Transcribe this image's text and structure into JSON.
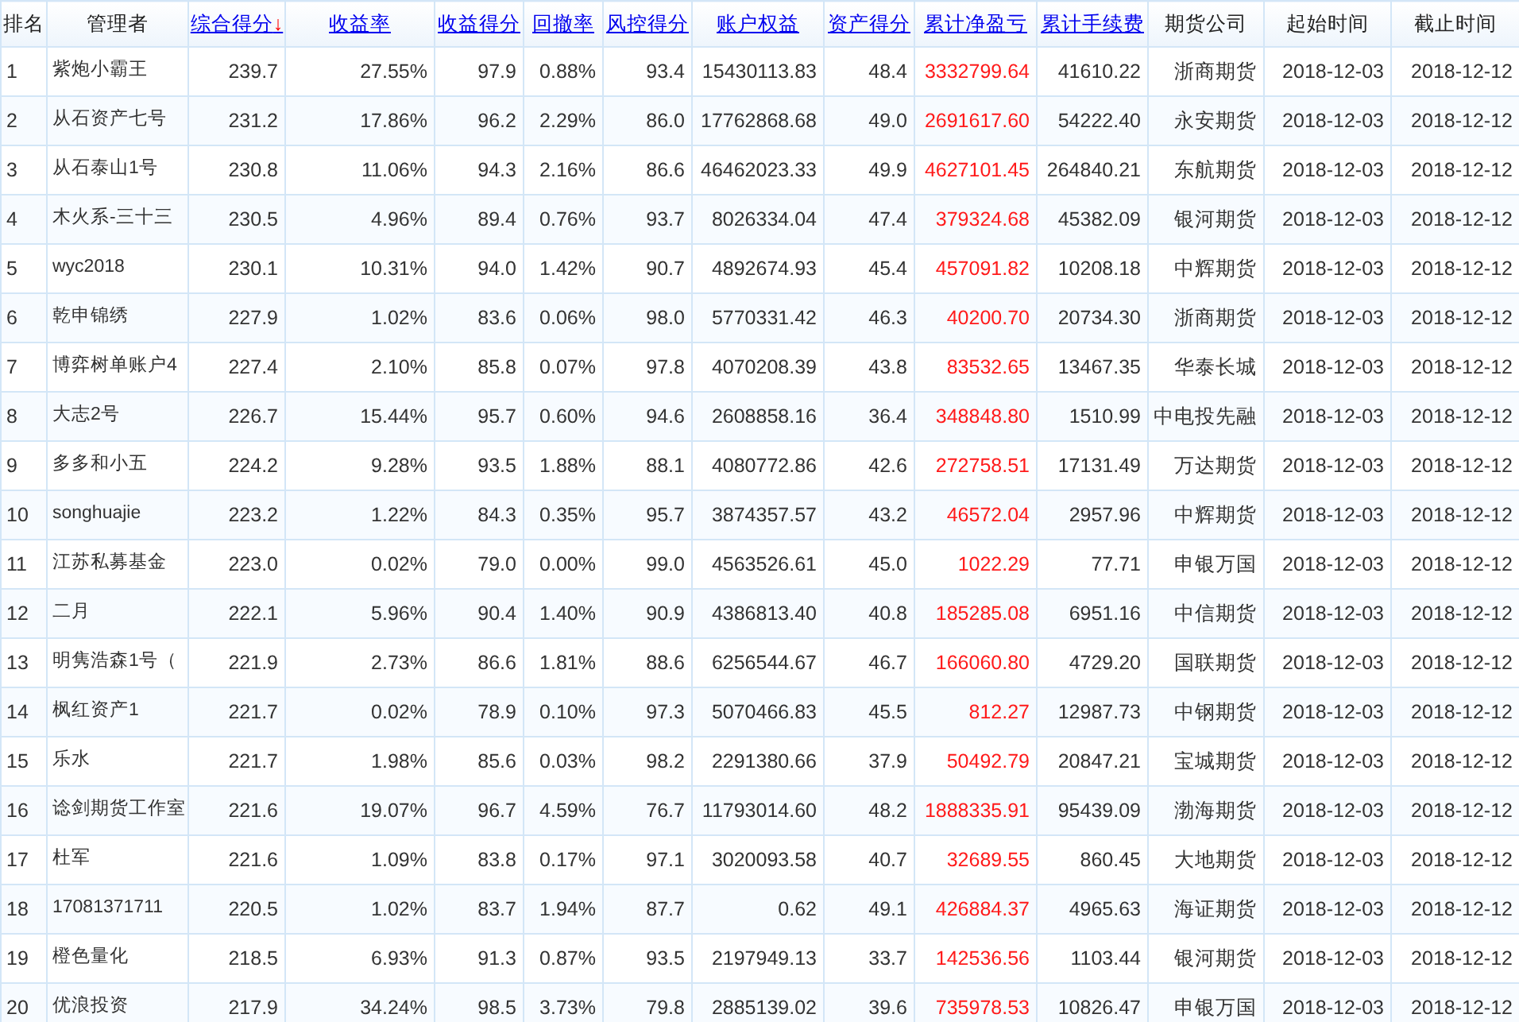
{
  "table": {
    "columns": [
      {
        "label": "排名",
        "sortable": false,
        "kind": "left"
      },
      {
        "label": "管理者",
        "sortable": false,
        "kind": "left"
      },
      {
        "label": "综合得分",
        "sortable": true,
        "sort_indicator": "↓",
        "kind": "number"
      },
      {
        "label": "收益率",
        "sortable": true,
        "kind": "number"
      },
      {
        "label": "收益得分",
        "sortable": true,
        "kind": "number"
      },
      {
        "label": "回撤率",
        "sortable": true,
        "kind": "number"
      },
      {
        "label": "风控得分",
        "sortable": true,
        "kind": "number"
      },
      {
        "label": "账户权益",
        "sortable": true,
        "kind": "number"
      },
      {
        "label": "资产得分",
        "sortable": true,
        "kind": "number"
      },
      {
        "label": "累计净盈亏",
        "sortable": true,
        "kind": "gain"
      },
      {
        "label": "累计手续费",
        "sortable": true,
        "kind": "number"
      },
      {
        "label": "期货公司",
        "sortable": false,
        "kind": "number"
      },
      {
        "label": "起始时间",
        "sortable": false,
        "kind": "number"
      },
      {
        "label": "截止时间",
        "sortable": false,
        "kind": "number"
      }
    ],
    "rows": [
      [
        "1",
        "紫炮小霸王",
        "239.7",
        "27.55%",
        "97.9",
        "0.88%",
        "93.4",
        "15430113.83",
        "48.4",
        "3332799.64",
        "41610.22",
        "浙商期货",
        "2018-12-03",
        "2018-12-12"
      ],
      [
        "2",
        "从石资产七号",
        "231.2",
        "17.86%",
        "96.2",
        "2.29%",
        "86.0",
        "17762868.68",
        "49.0",
        "2691617.60",
        "54222.40",
        "永安期货",
        "2018-12-03",
        "2018-12-12"
      ],
      [
        "3",
        "从石泰山1号",
        "230.8",
        "11.06%",
        "94.3",
        "2.16%",
        "86.6",
        "46462023.33",
        "49.9",
        "4627101.45",
        "264840.21",
        "东航期货",
        "2018-12-03",
        "2018-12-12"
      ],
      [
        "4",
        "木火系-三十三",
        "230.5",
        "4.96%",
        "89.4",
        "0.76%",
        "93.7",
        "8026334.04",
        "47.4",
        "379324.68",
        "45382.09",
        "银河期货",
        "2018-12-03",
        "2018-12-12"
      ],
      [
        "5",
        "wyc2018",
        "230.1",
        "10.31%",
        "94.0",
        "1.42%",
        "90.7",
        "4892674.93",
        "45.4",
        "457091.82",
        "10208.18",
        "中辉期货",
        "2018-12-03",
        "2018-12-12"
      ],
      [
        "6",
        "乾申锦绣",
        "227.9",
        "1.02%",
        "83.6",
        "0.06%",
        "98.0",
        "5770331.42",
        "46.3",
        "40200.70",
        "20734.30",
        "浙商期货",
        "2018-12-03",
        "2018-12-12"
      ],
      [
        "7",
        "博弈树单账户4",
        "227.4",
        "2.10%",
        "85.8",
        "0.07%",
        "97.8",
        "4070208.39",
        "43.8",
        "83532.65",
        "13467.35",
        "华泰长城",
        "2018-12-03",
        "2018-12-12"
      ],
      [
        "8",
        "大志2号",
        "226.7",
        "15.44%",
        "95.7",
        "0.60%",
        "94.6",
        "2608858.16",
        "36.4",
        "348848.80",
        "1510.99",
        "中电投先融",
        "2018-12-03",
        "2018-12-12"
      ],
      [
        "9",
        "多多和小五",
        "224.2",
        "9.28%",
        "93.5",
        "1.88%",
        "88.1",
        "4080772.86",
        "42.6",
        "272758.51",
        "17131.49",
        "万达期货",
        "2018-12-03",
        "2018-12-12"
      ],
      [
        "10",
        "songhuajie",
        "223.2",
        "1.22%",
        "84.3",
        "0.35%",
        "95.7",
        "3874357.57",
        "43.2",
        "46572.04",
        "2957.96",
        "中辉期货",
        "2018-12-03",
        "2018-12-12"
      ],
      [
        "11",
        "江苏私募基金",
        "223.0",
        "0.02%",
        "79.0",
        "0.00%",
        "99.0",
        "4563526.61",
        "45.0",
        "1022.29",
        "77.71",
        "申银万国",
        "2018-12-03",
        "2018-12-12"
      ],
      [
        "12",
        "二月",
        "222.1",
        "5.96%",
        "90.4",
        "1.40%",
        "90.9",
        "4386813.40",
        "40.8",
        "185285.08",
        "6951.16",
        "中信期货",
        "2018-12-03",
        "2018-12-12"
      ],
      [
        "13",
        "明隽浩森1号（",
        "221.9",
        "2.73%",
        "86.6",
        "1.81%",
        "88.6",
        "6256544.67",
        "46.7",
        "166060.80",
        "4729.20",
        "国联期货",
        "2018-12-03",
        "2018-12-12"
      ],
      [
        "14",
        "枫红资产1",
        "221.7",
        "0.02%",
        "78.9",
        "0.10%",
        "97.3",
        "5070466.83",
        "45.5",
        "812.27",
        "12987.73",
        "中钢期货",
        "2018-12-03",
        "2018-12-12"
      ],
      [
        "15",
        "乐水",
        "221.7",
        "1.98%",
        "85.6",
        "0.03%",
        "98.2",
        "2291380.66",
        "37.9",
        "50492.79",
        "20847.21",
        "宝城期货",
        "2018-12-03",
        "2018-12-12"
      ],
      [
        "16",
        "谂剑期货工作室",
        "221.6",
        "19.07%",
        "96.7",
        "4.59%",
        "76.7",
        "11793014.60",
        "48.2",
        "1888335.91",
        "95439.09",
        "渤海期货",
        "2018-12-03",
        "2018-12-12"
      ],
      [
        "17",
        "杜军",
        "221.6",
        "1.09%",
        "83.8",
        "0.17%",
        "97.1",
        "3020093.58",
        "40.7",
        "32689.55",
        "860.45",
        "大地期货",
        "2018-12-03",
        "2018-12-12"
      ],
      [
        "18",
        "17081371711",
        "220.5",
        "1.02%",
        "83.7",
        "1.94%",
        "87.7",
        "0.62",
        "49.1",
        "426884.37",
        "4965.63",
        "海证期货",
        "2018-12-03",
        "2018-12-12"
      ],
      [
        "19",
        "橙色量化",
        "218.5",
        "6.93%",
        "91.3",
        "0.87%",
        "93.5",
        "2197949.13",
        "33.7",
        "142536.56",
        "1103.44",
        "银河期货",
        "2018-12-03",
        "2018-12-12"
      ],
      [
        "20",
        "优浪投资",
        "217.9",
        "34.24%",
        "98.5",
        "3.73%",
        "79.8",
        "2885139.02",
        "39.6",
        "735978.53",
        "10826.47",
        "申银万国",
        "2018-12-03",
        "2018-12-12"
      ]
    ]
  }
}
